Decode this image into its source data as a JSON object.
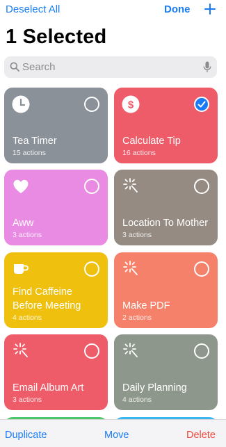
{
  "nav": {
    "deselect_label": "Deselect All",
    "done_label": "Done"
  },
  "title": "1 Selected",
  "search": {
    "placeholder": "Search"
  },
  "shortcuts": [
    {
      "name": "Tea Timer",
      "count": "15 actions",
      "color": "#8b9199",
      "icon": "clock-icon",
      "selected": false
    },
    {
      "name": "Calculate Tip",
      "count": "16 actions",
      "color": "#ee5b69",
      "icon": "dollar-icon",
      "selected": true
    },
    {
      "name": "Aww",
      "count": "3 actions",
      "color": "#e98be3",
      "icon": "heart-icon",
      "selected": false
    },
    {
      "name": "Location To Mother",
      "count": "3 actions",
      "color": "#958b83",
      "icon": "sparkle-icon",
      "selected": false
    },
    {
      "name": "Find Caffeine Before Meeting",
      "count": "4 actions",
      "color": "#efc00d",
      "icon": "coffee-icon",
      "selected": false
    },
    {
      "name": "Make PDF",
      "count": "2 actions",
      "color": "#f6816a",
      "icon": "sparkle-icon",
      "selected": false
    },
    {
      "name": "Email Album Art",
      "count": "3 actions",
      "color": "#ed5c68",
      "icon": "sparkle-icon",
      "selected": false
    },
    {
      "name": "Daily Planning",
      "count": "4 actions",
      "color": "#8e978b",
      "icon": "sparkle-icon",
      "selected": false
    }
  ],
  "peek_colors": [
    "#4dc76a",
    "#3cb7ee"
  ],
  "toolbar": {
    "duplicate_label": "Duplicate",
    "move_label": "Move",
    "delete_label": "Delete"
  },
  "colors": {
    "accent": "#1a7cf5",
    "destructive": "#f2473c"
  }
}
